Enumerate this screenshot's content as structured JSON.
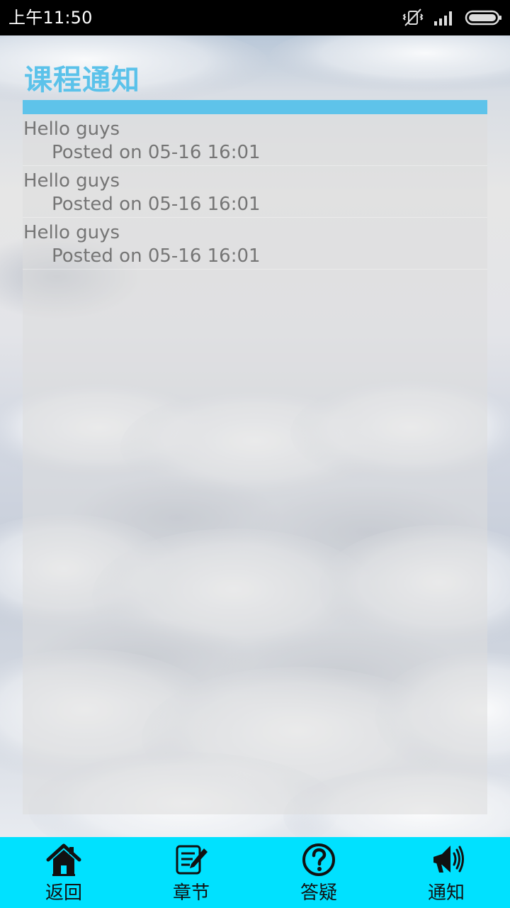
{
  "status_bar": {
    "time": "上午11:50",
    "icons": [
      "vibrate-off-icon",
      "signal-icon",
      "battery-icon"
    ]
  },
  "page": {
    "title": "课程通知",
    "accent_color": "#5ec3ea",
    "title_color": "#5bc2ea"
  },
  "notices": [
    {
      "title": "Hello guys",
      "meta": "Posted on 05-16 16:01"
    },
    {
      "title": "Hello guys",
      "meta": "Posted on 05-16 16:01"
    },
    {
      "title": "Hello guys",
      "meta": "Posted on 05-16 16:01"
    }
  ],
  "bottom_nav": {
    "background": "#00e1ff",
    "items": [
      {
        "label": "返回",
        "icon": "home-icon"
      },
      {
        "label": "章节",
        "icon": "edit-note-icon"
      },
      {
        "label": "答疑",
        "icon": "question-icon"
      },
      {
        "label": "通知",
        "icon": "megaphone-icon"
      }
    ]
  }
}
